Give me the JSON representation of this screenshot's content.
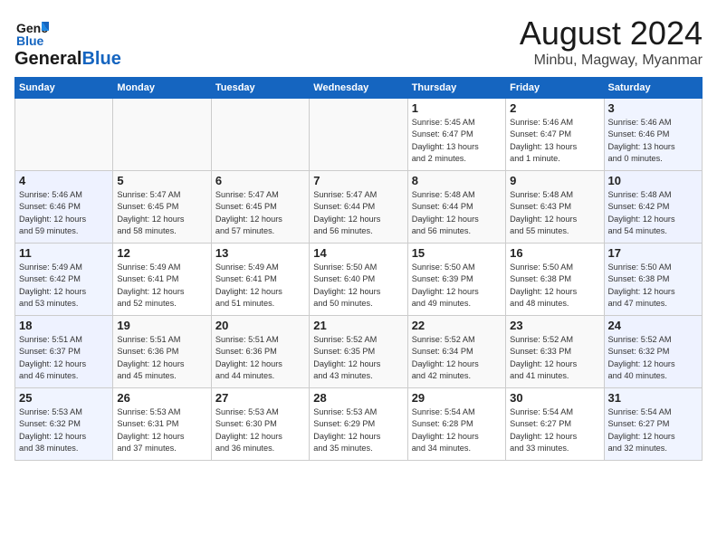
{
  "header": {
    "logo_line1": "General",
    "logo_line2": "Blue",
    "month": "August 2024",
    "location": "Minbu, Magway, Myanmar"
  },
  "columns": [
    "Sunday",
    "Monday",
    "Tuesday",
    "Wednesday",
    "Thursday",
    "Friday",
    "Saturday"
  ],
  "weeks": [
    [
      {
        "day": "",
        "info": ""
      },
      {
        "day": "",
        "info": ""
      },
      {
        "day": "",
        "info": ""
      },
      {
        "day": "",
        "info": ""
      },
      {
        "day": "1",
        "info": "Sunrise: 5:45 AM\nSunset: 6:47 PM\nDaylight: 13 hours\nand 2 minutes."
      },
      {
        "day": "2",
        "info": "Sunrise: 5:46 AM\nSunset: 6:47 PM\nDaylight: 13 hours\nand 1 minute."
      },
      {
        "day": "3",
        "info": "Sunrise: 5:46 AM\nSunset: 6:46 PM\nDaylight: 13 hours\nand 0 minutes."
      }
    ],
    [
      {
        "day": "4",
        "info": "Sunrise: 5:46 AM\nSunset: 6:46 PM\nDaylight: 12 hours\nand 59 minutes."
      },
      {
        "day": "5",
        "info": "Sunrise: 5:47 AM\nSunset: 6:45 PM\nDaylight: 12 hours\nand 58 minutes."
      },
      {
        "day": "6",
        "info": "Sunrise: 5:47 AM\nSunset: 6:45 PM\nDaylight: 12 hours\nand 57 minutes."
      },
      {
        "day": "7",
        "info": "Sunrise: 5:47 AM\nSunset: 6:44 PM\nDaylight: 12 hours\nand 56 minutes."
      },
      {
        "day": "8",
        "info": "Sunrise: 5:48 AM\nSunset: 6:44 PM\nDaylight: 12 hours\nand 56 minutes."
      },
      {
        "day": "9",
        "info": "Sunrise: 5:48 AM\nSunset: 6:43 PM\nDaylight: 12 hours\nand 55 minutes."
      },
      {
        "day": "10",
        "info": "Sunrise: 5:48 AM\nSunset: 6:42 PM\nDaylight: 12 hours\nand 54 minutes."
      }
    ],
    [
      {
        "day": "11",
        "info": "Sunrise: 5:49 AM\nSunset: 6:42 PM\nDaylight: 12 hours\nand 53 minutes."
      },
      {
        "day": "12",
        "info": "Sunrise: 5:49 AM\nSunset: 6:41 PM\nDaylight: 12 hours\nand 52 minutes."
      },
      {
        "day": "13",
        "info": "Sunrise: 5:49 AM\nSunset: 6:41 PM\nDaylight: 12 hours\nand 51 minutes."
      },
      {
        "day": "14",
        "info": "Sunrise: 5:50 AM\nSunset: 6:40 PM\nDaylight: 12 hours\nand 50 minutes."
      },
      {
        "day": "15",
        "info": "Sunrise: 5:50 AM\nSunset: 6:39 PM\nDaylight: 12 hours\nand 49 minutes."
      },
      {
        "day": "16",
        "info": "Sunrise: 5:50 AM\nSunset: 6:38 PM\nDaylight: 12 hours\nand 48 minutes."
      },
      {
        "day": "17",
        "info": "Sunrise: 5:50 AM\nSunset: 6:38 PM\nDaylight: 12 hours\nand 47 minutes."
      }
    ],
    [
      {
        "day": "18",
        "info": "Sunrise: 5:51 AM\nSunset: 6:37 PM\nDaylight: 12 hours\nand 46 minutes."
      },
      {
        "day": "19",
        "info": "Sunrise: 5:51 AM\nSunset: 6:36 PM\nDaylight: 12 hours\nand 45 minutes."
      },
      {
        "day": "20",
        "info": "Sunrise: 5:51 AM\nSunset: 6:36 PM\nDaylight: 12 hours\nand 44 minutes."
      },
      {
        "day": "21",
        "info": "Sunrise: 5:52 AM\nSunset: 6:35 PM\nDaylight: 12 hours\nand 43 minutes."
      },
      {
        "day": "22",
        "info": "Sunrise: 5:52 AM\nSunset: 6:34 PM\nDaylight: 12 hours\nand 42 minutes."
      },
      {
        "day": "23",
        "info": "Sunrise: 5:52 AM\nSunset: 6:33 PM\nDaylight: 12 hours\nand 41 minutes."
      },
      {
        "day": "24",
        "info": "Sunrise: 5:52 AM\nSunset: 6:32 PM\nDaylight: 12 hours\nand 40 minutes."
      }
    ],
    [
      {
        "day": "25",
        "info": "Sunrise: 5:53 AM\nSunset: 6:32 PM\nDaylight: 12 hours\nand 38 minutes."
      },
      {
        "day": "26",
        "info": "Sunrise: 5:53 AM\nSunset: 6:31 PM\nDaylight: 12 hours\nand 37 minutes."
      },
      {
        "day": "27",
        "info": "Sunrise: 5:53 AM\nSunset: 6:30 PM\nDaylight: 12 hours\nand 36 minutes."
      },
      {
        "day": "28",
        "info": "Sunrise: 5:53 AM\nSunset: 6:29 PM\nDaylight: 12 hours\nand 35 minutes."
      },
      {
        "day": "29",
        "info": "Sunrise: 5:54 AM\nSunset: 6:28 PM\nDaylight: 12 hours\nand 34 minutes."
      },
      {
        "day": "30",
        "info": "Sunrise: 5:54 AM\nSunset: 6:27 PM\nDaylight: 12 hours\nand 33 minutes."
      },
      {
        "day": "31",
        "info": "Sunrise: 5:54 AM\nSunset: 6:27 PM\nDaylight: 12 hours\nand 32 minutes."
      }
    ]
  ]
}
